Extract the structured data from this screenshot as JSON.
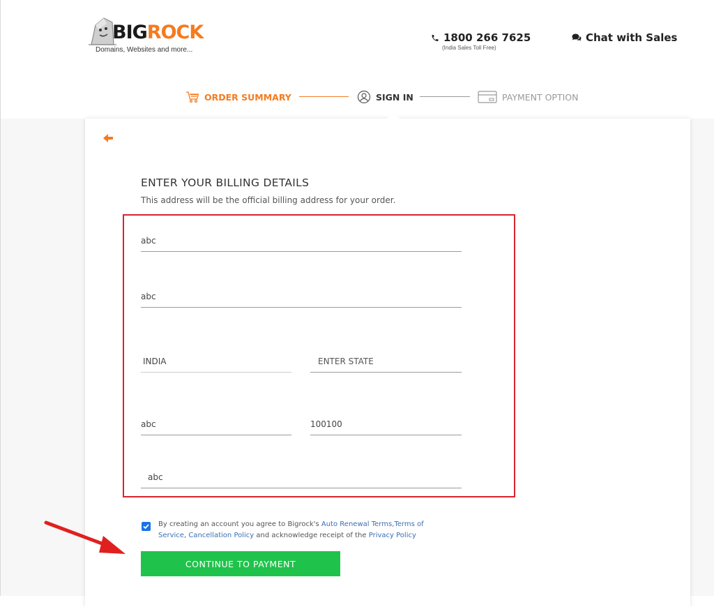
{
  "brand": {
    "logo_text_1": "BIG",
    "logo_text_2": "ROCK",
    "tagline": "Domains, Websites and more...",
    "primary_color": "#f47b20"
  },
  "header": {
    "phone_icon": "phone-icon",
    "phone": "1800 266 7625",
    "phone_note": "(India Sales Toll Free)",
    "chat_icon": "chat-bubble-icon",
    "chat_label": "Chat with Sales"
  },
  "steps": [
    {
      "label": "ORDER SUMMARY",
      "icon": "cart-icon",
      "state": "completed"
    },
    {
      "label": "SIGN IN",
      "icon": "user-circle-icon",
      "state": "current"
    },
    {
      "label": "PAYMENT OPTION",
      "icon": "credit-card-icon",
      "state": "pending"
    }
  ],
  "form": {
    "back_icon": "arrow-left-icon",
    "title": "ENTER YOUR BILLING DETAILS",
    "subtitle": "This address will be the official billing address for your order.",
    "address_line1": "abc",
    "address_line2": "abc",
    "country": "INDIA",
    "state_placeholder": "ENTER STATE",
    "city": "abc",
    "zipcode": "100100",
    "phone": "abc",
    "highlight_color": "#d9232d"
  },
  "consent": {
    "checked": true,
    "text_1": "By creating an account you agree to Bigrock's ",
    "link_1": "Auto Renewal Terms,",
    "link_2": "Terms of Service",
    "text_2": ", ",
    "link_3": "Cancellation Policy",
    "text_3": " and acknowledge receipt of the ",
    "link_4": "Privacy Policy"
  },
  "cta": {
    "label": "CONTINUE TO PAYMENT",
    "color": "#1fc34b"
  },
  "annotation": {
    "arrow_icon": "red-pointer-arrow-icon",
    "arrow_color": "#e02020"
  }
}
